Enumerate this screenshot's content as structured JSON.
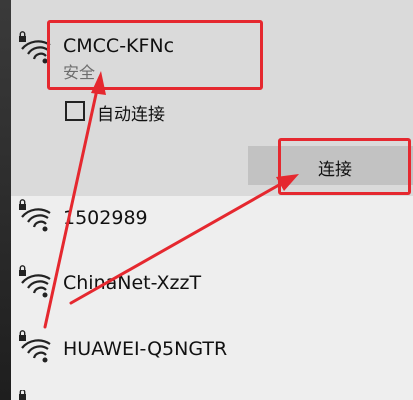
{
  "selected_network": {
    "ssid": "CMCC-KFNc",
    "security": "安全",
    "auto_connect_label": "自动连接",
    "auto_connect_checked": false,
    "connect_button_label": "连接",
    "signal_icon": "wifi-secured-icon"
  },
  "networks": [
    {
      "ssid": "1502989",
      "signal_icon": "wifi-secured-icon"
    },
    {
      "ssid": "ChinaNet-XzzT",
      "signal_icon": "wifi-secured-icon"
    },
    {
      "ssid": "HUAWEI-Q5NGTR",
      "signal_icon": "wifi-secured-icon"
    }
  ],
  "colors": {
    "highlight": "#e5282f",
    "selected_background": "#dadada",
    "list_background": "#eeeeee",
    "button_background": "#c2c2c2"
  }
}
